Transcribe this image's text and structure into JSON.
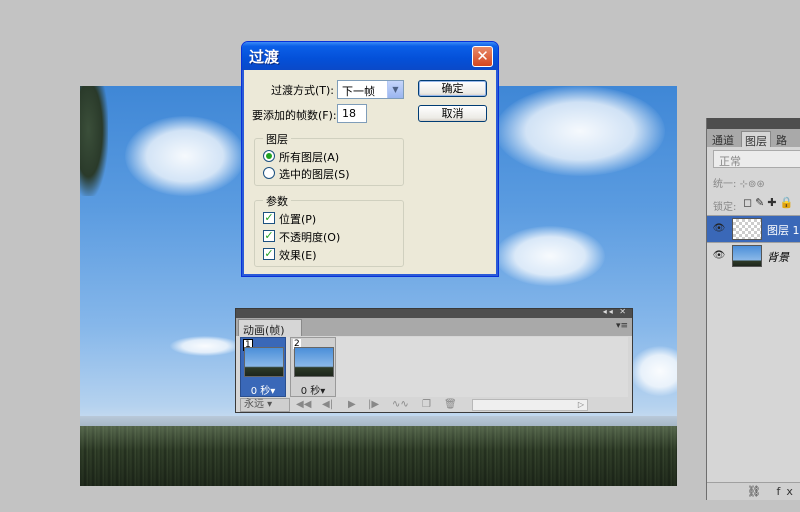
{
  "dialog": {
    "title": "过渡",
    "close_glyph": "✕",
    "transition_label": "过渡方式(T):",
    "transition_value": "下一帧",
    "frames_label": "要添加的帧数(F):",
    "frames_value": "18",
    "ok_label": "确定",
    "cancel_label": "取消",
    "layers_group": {
      "title": "图层",
      "options": [
        {
          "label": "所有图层(A)",
          "selected": true
        },
        {
          "label": "选中的图层(S)",
          "selected": false
        }
      ]
    },
    "params_group": {
      "title": "参数",
      "options": [
        {
          "label": "位置(P)",
          "checked": true
        },
        {
          "label": "不透明度(O)",
          "checked": true
        },
        {
          "label": "效果(E)",
          "checked": true
        }
      ]
    }
  },
  "animation_panel": {
    "tab_label": "动画(帧)",
    "menu_glyph": "▾≡",
    "top_controls": "◂◂ ✕",
    "frames": [
      {
        "number": "1",
        "delay": "0 秒▾",
        "selected": true
      },
      {
        "number": "2",
        "delay": "0 秒▾",
        "selected": false
      }
    ],
    "loop_value": "永远 ▾",
    "controls": {
      "first": "◀◀",
      "prev": "◀|",
      "play": "▶",
      "next": "|▶",
      "tween": "∿∿",
      "new_frame": "❐",
      "delete": "🗑",
      "scroll_right": "▷"
    }
  },
  "layers_panel": {
    "tabs": [
      {
        "label": "通道",
        "active": false
      },
      {
        "label": "图层",
        "active": true
      },
      {
        "label": "路径",
        "active": false
      }
    ],
    "blend_mode": "正常",
    "unify_label": "统一:",
    "unify_icons": "⊹⊚⊛",
    "lock_label": "锁定:",
    "lock_icons": "◻✎✚🔒",
    "layers": [
      {
        "name": "图层 1",
        "selected": true,
        "thumb": "transparent"
      },
      {
        "name": "背景",
        "selected": false,
        "thumb": "photo"
      }
    ],
    "eye_glyph": "👁",
    "bottom_icons": "⛓ fx"
  }
}
